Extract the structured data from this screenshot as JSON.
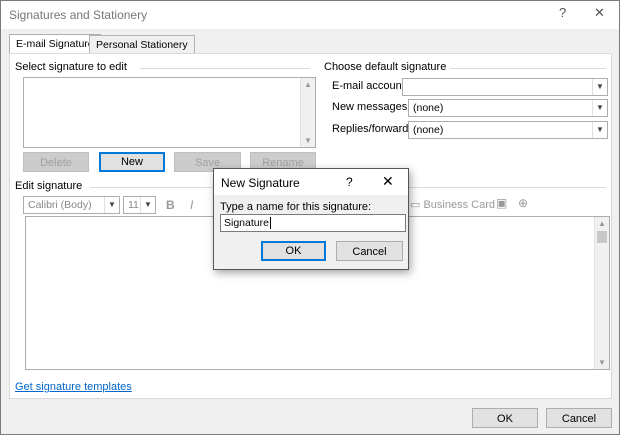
{
  "window": {
    "title": "Signatures and Stationery",
    "help": "?",
    "close": "✕"
  },
  "tabs": [
    {
      "label": "E-mail Signature"
    },
    {
      "label": "Personal Stationery"
    }
  ],
  "select_section": {
    "title": "Select signature to edit",
    "buttons": {
      "delete": "Delete",
      "new": "New",
      "save": "Save",
      "rename": "Rename"
    }
  },
  "default_section": {
    "title": "Choose default signature",
    "email_account_label": "E-mail account:",
    "email_account_value": "",
    "new_messages_label": "New messages:",
    "new_messages_value": "(none)",
    "replies_label": "Replies/forwards:",
    "replies_value": "(none)"
  },
  "edit_section": {
    "title": "Edit signature",
    "font": "Calibri (Body)",
    "size": "11",
    "bold": "B",
    "italic": "I",
    "business_card": "Business Card"
  },
  "templates_link": "Get signature templates",
  "footer": {
    "ok": "OK",
    "cancel": "Cancel"
  },
  "dialog": {
    "title": "New Signature",
    "help": "?",
    "close": "✕",
    "prompt": "Type a name for this signature:",
    "value": "Signature",
    "ok": "OK",
    "cancel": "Cancel"
  }
}
